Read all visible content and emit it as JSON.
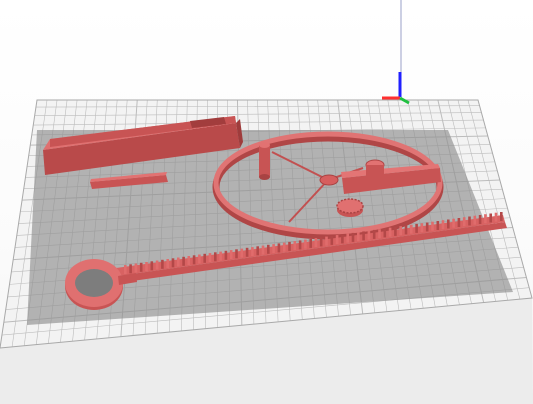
{
  "scene": {
    "background_color": "#ffffff",
    "bed_color": "#f2f2f2",
    "bed_shadow_color": "#9a9a9a",
    "grid_color": "#bcbcbc",
    "model_color": "#d45a5a",
    "model_dark": "#b04646",
    "model_light": "#e27272",
    "axis_colors": {
      "x": "#ff3030",
      "y": "#20c040",
      "z": "#2020ff"
    },
    "objects": [
      "rack-holder-bar",
      "small-pin",
      "wheel-with-spokes",
      "spoke-hub-peg",
      "crank-arm",
      "small-gear",
      "long-rack-gear-strip",
      "handle-ring-rack"
    ]
  }
}
